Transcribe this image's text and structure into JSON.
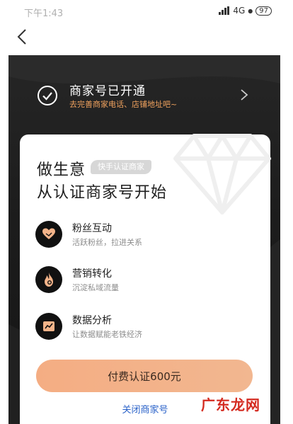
{
  "status_bar": {
    "time": "下午1:43",
    "network": "4G",
    "battery": "97"
  },
  "banner": {
    "title": "商家号已开通",
    "subtitle": "去完善商家电话、店铺地址吧~"
  },
  "card": {
    "headline_line1": "做生意",
    "tag": "快手认证商家",
    "headline_line2": "从认证商家号开始",
    "features": [
      {
        "title": "粉丝互动",
        "desc": "活跃粉丝，拉进关系",
        "icon": "heart-hands-icon"
      },
      {
        "title": "营销转化",
        "desc": "沉淀私域流量",
        "icon": "fire-icon"
      },
      {
        "title": "数据分析",
        "desc": "让数据赋能老铁经济",
        "icon": "chart-icon"
      }
    ],
    "pay_button": "付费认证600元",
    "close_link": "关闭商家号"
  },
  "colors": {
    "accent": "#f4ad83",
    "link": "#2a62c9",
    "subtitle_orange": "#f0a25e",
    "dark_bg": "#1c1c1c"
  },
  "watermark": "广东龙网"
}
